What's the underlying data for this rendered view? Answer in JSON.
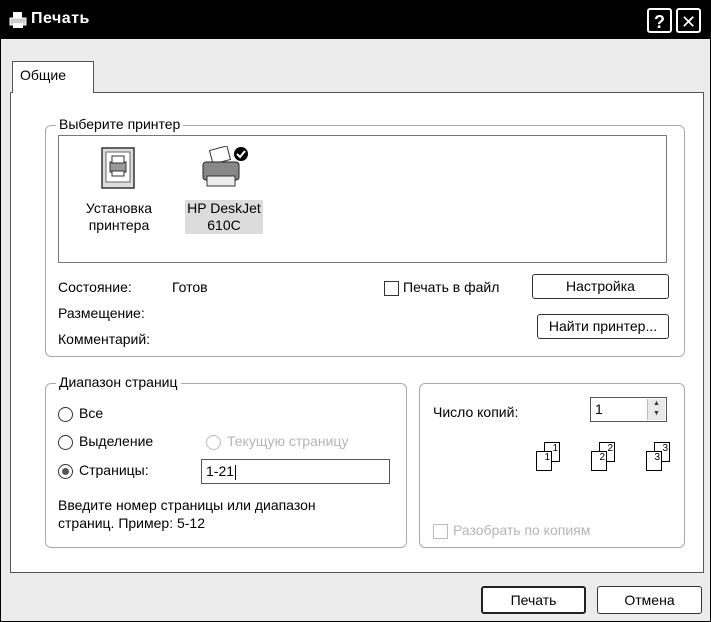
{
  "window": {
    "title": "Печать"
  },
  "titlebar": {
    "help": "?",
    "close": "✕"
  },
  "tabs": [
    {
      "label": "Общие"
    }
  ],
  "printer_group": {
    "label": "Выберите принтер",
    "printers": [
      {
        "line1": "Установка",
        "line2": "принтера"
      },
      {
        "line1": "HP DeskJet",
        "line2": "610C"
      }
    ],
    "status_label": "Состояние:",
    "status_value": "Готов",
    "location_label": "Размещение:",
    "comment_label": "Комментарий:",
    "print_to_file": "Печать в файл",
    "setup_button": "Настройка",
    "find_button": "Найти принтер..."
  },
  "range_group": {
    "label": "Диапазон страниц",
    "all": "Все",
    "selection": "Выделение",
    "current": "Текущую страницу",
    "pages": "Страницы:",
    "pages_value": "1-21",
    "hint1": "Введите номер страницы или диапазон",
    "hint2": "страниц. Пример: 5-12"
  },
  "copies_group": {
    "copies_label": "Число копий:",
    "copies_value": "1",
    "collate": "Разобрать по копиям",
    "collate_pages": [
      "1",
      "1",
      "2",
      "2",
      "3",
      "3"
    ]
  },
  "footer": {
    "print_button": "Печать",
    "cancel_button": "Отмена"
  }
}
